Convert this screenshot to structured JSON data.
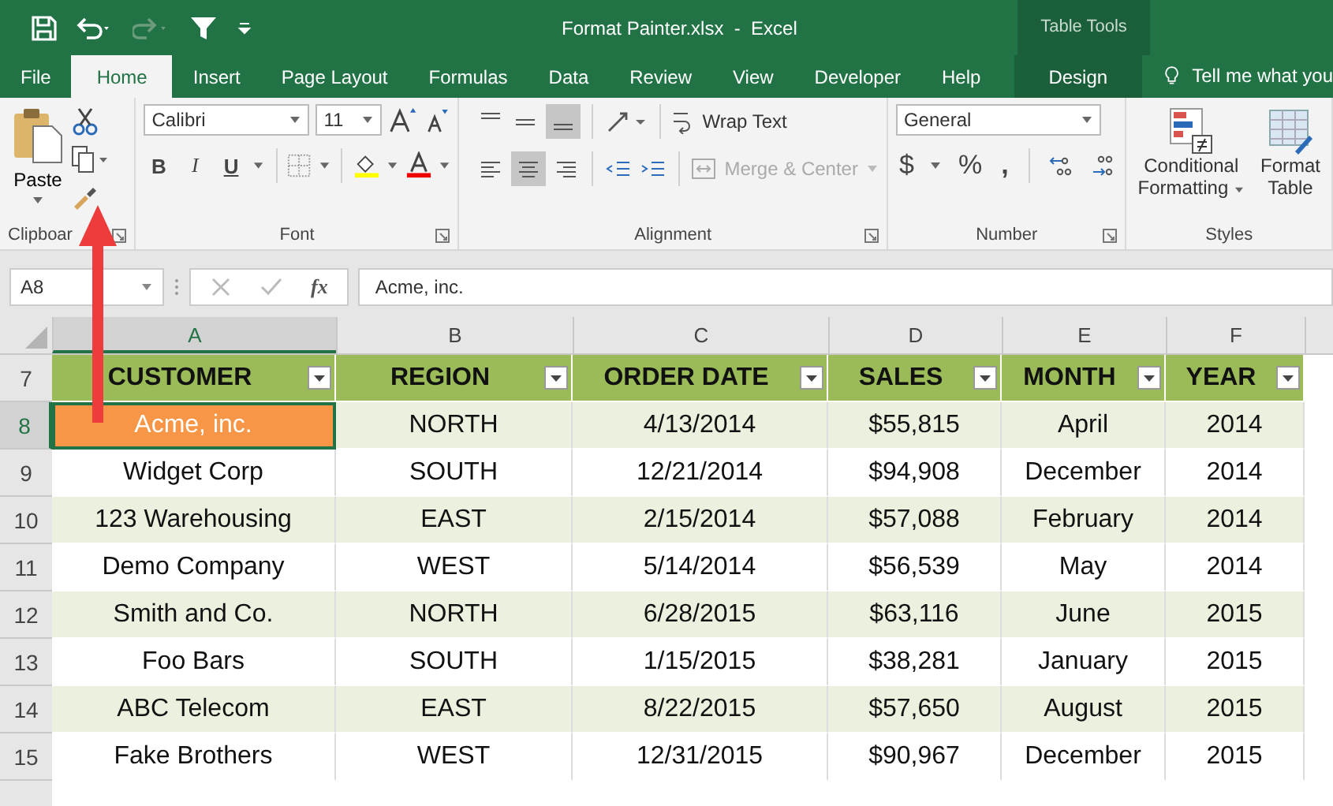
{
  "title_bar": {
    "title": "Format Painter.xlsx  -  Excel",
    "contextual_label": "Table Tools"
  },
  "tabs": [
    {
      "label": "File",
      "selected": false,
      "contextual": false
    },
    {
      "label": "Home",
      "selected": true,
      "contextual": false
    },
    {
      "label": "Insert",
      "selected": false,
      "contextual": false
    },
    {
      "label": "Page Layout",
      "selected": false,
      "contextual": false
    },
    {
      "label": "Formulas",
      "selected": false,
      "contextual": false
    },
    {
      "label": "Data",
      "selected": false,
      "contextual": false
    },
    {
      "label": "Review",
      "selected": false,
      "contextual": false
    },
    {
      "label": "View",
      "selected": false,
      "contextual": false
    },
    {
      "label": "Developer",
      "selected": false,
      "contextual": false
    },
    {
      "label": "Help",
      "selected": false,
      "contextual": false
    },
    {
      "label": "Design",
      "selected": false,
      "contextual": true
    }
  ],
  "tell_me": "Tell me what you",
  "ribbon": {
    "clipboard": {
      "paste": "Paste",
      "label": "Clipboar"
    },
    "font": {
      "font_name": "Calibri",
      "font_size": "11",
      "bold": "B",
      "italic": "I",
      "underline": "U",
      "label": "Font"
    },
    "alignment": {
      "wrap_text": "Wrap Text",
      "merge_center": "Merge & Center",
      "merge_disabled": true,
      "label": "Alignment"
    },
    "number": {
      "format": "General",
      "currency": "$",
      "percent": "%",
      "comma": ",",
      "label": "Number"
    },
    "styles": {
      "conditional": [
        "Conditional",
        "Formatting"
      ],
      "format_table": [
        "Format",
        "Table"
      ],
      "label": "Styles"
    }
  },
  "formula_bar": {
    "name_box": "A8",
    "fx": "fx",
    "value": "Acme, inc."
  },
  "sheet": {
    "columns": [
      {
        "letter": "A",
        "selected": true
      },
      {
        "letter": "B",
        "selected": false
      },
      {
        "letter": "C",
        "selected": false
      },
      {
        "letter": "D",
        "selected": false
      },
      {
        "letter": "E",
        "selected": false
      },
      {
        "letter": "F",
        "selected": false
      }
    ],
    "header_row": {
      "number": "7",
      "labels": [
        "CUSTOMER",
        "REGION",
        "ORDER DATE",
        "SALES",
        "MONTH",
        "YEAR"
      ]
    },
    "rows": [
      {
        "number": "8",
        "selected": true,
        "cells": [
          "Acme, inc.",
          "NORTH",
          "4/13/2014",
          "$55,815",
          "April",
          "2014"
        ]
      },
      {
        "number": "9",
        "selected": false,
        "cells": [
          "Widget Corp",
          "SOUTH",
          "12/21/2014",
          "$94,908",
          "December",
          "2014"
        ]
      },
      {
        "number": "10",
        "selected": false,
        "cells": [
          "123 Warehousing",
          "EAST",
          "2/15/2014",
          "$57,088",
          "February",
          "2014"
        ]
      },
      {
        "number": "11",
        "selected": false,
        "cells": [
          "Demo Company",
          "WEST",
          "5/14/2014",
          "$56,539",
          "May",
          "2014"
        ]
      },
      {
        "number": "12",
        "selected": false,
        "cells": [
          "Smith and Co.",
          "NORTH",
          "6/28/2015",
          "$63,116",
          "June",
          "2015"
        ]
      },
      {
        "number": "13",
        "selected": false,
        "cells": [
          "Foo Bars",
          "SOUTH",
          "1/15/2015",
          "$38,281",
          "January",
          "2015"
        ]
      },
      {
        "number": "14",
        "selected": false,
        "cells": [
          "ABC Telecom",
          "EAST",
          "8/22/2015",
          "$57,650",
          "August",
          "2015"
        ]
      },
      {
        "number": "15",
        "selected": false,
        "cells": [
          "Fake Brothers",
          "WEST",
          "12/31/2015",
          "$90,967",
          "December",
          "2015"
        ]
      }
    ]
  }
}
